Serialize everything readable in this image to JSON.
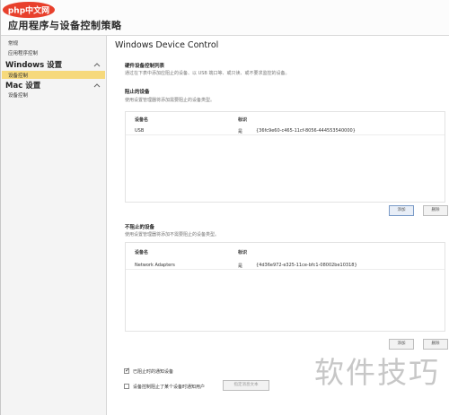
{
  "window": {
    "title": "应用程序与设备控制策略"
  },
  "watermark": {
    "logo_text": "php中文网",
    "corner_text": "软件技巧"
  },
  "sidebar": {
    "top_links": [
      "常规",
      "应用程序控制"
    ],
    "groups": [
      {
        "label": "Windows 设置",
        "expanded": true,
        "items": [
          "设备控制"
        ],
        "selected_index": 0
      },
      {
        "label": "Mac 设置",
        "expanded": true,
        "items": [
          "设备控制"
        ]
      }
    ]
  },
  "main": {
    "title": "Windows Device Control",
    "monitor_section": {
      "title": "硬件设备控制列表",
      "desc": "通过在下表中添加应阻止的设备、以 USB 端口等、或只读、或不要求监控的设备。"
    },
    "blocked_section": {
      "title": "阻止的设备",
      "desc": "使用设置管理器将添加需要阻止的设备类型。",
      "columns": [
        "设备名",
        "标识"
      ],
      "rows": [
        {
          "name": "USB",
          "flag": "是",
          "id": "{36fc9e60-c465-11cf-8056-444553540000}"
        }
      ],
      "buttons": [
        "添加",
        "删除"
      ]
    },
    "unblocked_section": {
      "title": "不阻止的设备",
      "desc": "使用设置管理器将添加不需要阻止的设备类型。",
      "columns": [
        "设备名",
        "标识"
      ],
      "rows": [
        {
          "name": "Network Adapters",
          "flag": "是",
          "id": "{4d36e972-e325-11ce-bfc1-08002be10318}"
        }
      ],
      "buttons": [
        "添加",
        "删除"
      ]
    },
    "options": {
      "notify_label": "已阻止时的通知设备",
      "notify_checked": true,
      "custom_label": "设备控制阻止了某个设备时通知用户",
      "custom_checked": false,
      "custom_button": "指定消息文本"
    }
  }
}
